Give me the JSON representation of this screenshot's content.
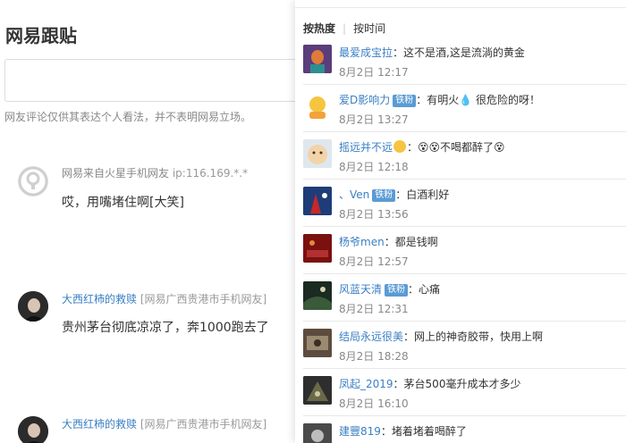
{
  "page_title": "网易跟贴",
  "disclaimer": "网友评论仅供其表达个人看法，并不表明网易立场。",
  "comments": [
    {
      "user": "网易来自火星手机网友",
      "meta": "ip:116.169.*.*",
      "text": "哎，用嘴堵住啊[大笑]"
    },
    {
      "user": "大西红柿的救赎",
      "meta": "[网易广西贵港市手机网友]",
      "text": "贵州茅台彻底凉凉了，奔1000跑去了"
    },
    {
      "user": "大西红柿的救赎",
      "meta": "[网易广西贵港市手机网友]",
      "text": ""
    }
  ],
  "panel": {
    "tabs": [
      {
        "label": "按热度",
        "active": true
      },
      {
        "label": "按时间",
        "active": false
      }
    ],
    "items": [
      {
        "name": "最爱成宝拉",
        "badge": "",
        "text": "：这不是酒,这是流淌的黄金",
        "time": "8月2日 12:17"
      },
      {
        "name": "爱D影响力",
        "badge": "铁粉",
        "text": "：有明火💧 很危险的呀！",
        "time": "8月2日 13:27"
      },
      {
        "name": "摇远并不远",
        "badge": "",
        "text": "：😵😵不喝都醉了😵",
        "time": "8月2日 12:18"
      },
      {
        "name": "、Ven",
        "badge": "铁粉",
        "text": "：白酒利好",
        "time": "8月2日 13:56"
      },
      {
        "name": "杨爷men",
        "badge": "",
        "text": "：都是钱啊",
        "time": "8月2日 12:57"
      },
      {
        "name": "风蓝天清",
        "badge": "铁粉",
        "text": "：心痛",
        "time": "8月2日 12:31"
      },
      {
        "name": "结局永远很美",
        "badge": "",
        "text": "：网上的神奇胶带，快用上啊",
        "time": "8月2日 18:28"
      },
      {
        "name": "凤起_2019",
        "badge": "",
        "text": "：茅台500毫升成本才多少",
        "time": "8月2日 16:10"
      },
      {
        "name": "建豐819",
        "badge": "",
        "text": "：堵着堵着喝醉了",
        "time": ""
      }
    ]
  }
}
